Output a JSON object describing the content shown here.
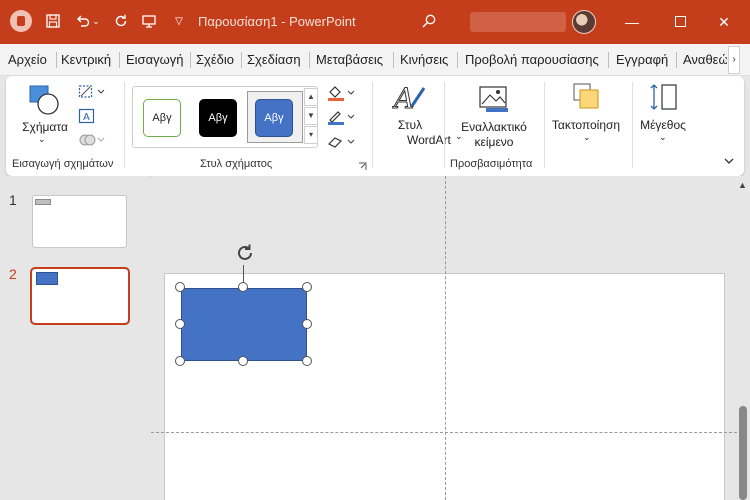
{
  "titlebar": {
    "doc_title": "Παρουσίαση1  -  PowerPoint",
    "app_color": "#c43e1c"
  },
  "tabs": [
    {
      "label": "Αρχείο"
    },
    {
      "label": "Κεντρική"
    },
    {
      "label": "Εισαγωγή"
    },
    {
      "label": "Σχέδιο"
    },
    {
      "label": "Σχεδίαση"
    },
    {
      "label": "Μεταβάσεις"
    },
    {
      "label": "Κινήσεις"
    },
    {
      "label": "Προβολή παρουσίασης"
    },
    {
      "label": "Εγγραφή"
    },
    {
      "label": "Αναθεώ"
    }
  ],
  "ribbon": {
    "insert_shapes": {
      "shapes_label": "Σχήματα",
      "group_label": "Εισαγωγή σχημάτων"
    },
    "shape_styles": {
      "swatches": [
        {
          "text": "Αβγ",
          "bg": "#ffffff",
          "fg": "#222222",
          "border": "#70ad47"
        },
        {
          "text": "Αβγ",
          "bg": "#000000",
          "fg": "#ffffff",
          "border": "#000000"
        },
        {
          "text": "Αβγ",
          "bg": "#4472c4",
          "fg": "#ffffff",
          "border": "#2f528f"
        }
      ],
      "group_label": "Στυλ σχήματος"
    },
    "wordart": {
      "label_line1": "Στυλ",
      "label_line2": "WordArt"
    },
    "accessibility": {
      "alt_text_line1": "Εναλλακτικό",
      "alt_text_line2": "κείμενο",
      "group_label": "Προσβασιμότητα"
    },
    "arrange": {
      "label": "Τακτοποίηση"
    },
    "size": {
      "label": "Μέγεθος"
    }
  },
  "slides": [
    {
      "number": "1"
    },
    {
      "number": "2"
    }
  ],
  "colors": {
    "selected_slide_border": "#c43e1c",
    "shape_fill": "#4472c4"
  }
}
